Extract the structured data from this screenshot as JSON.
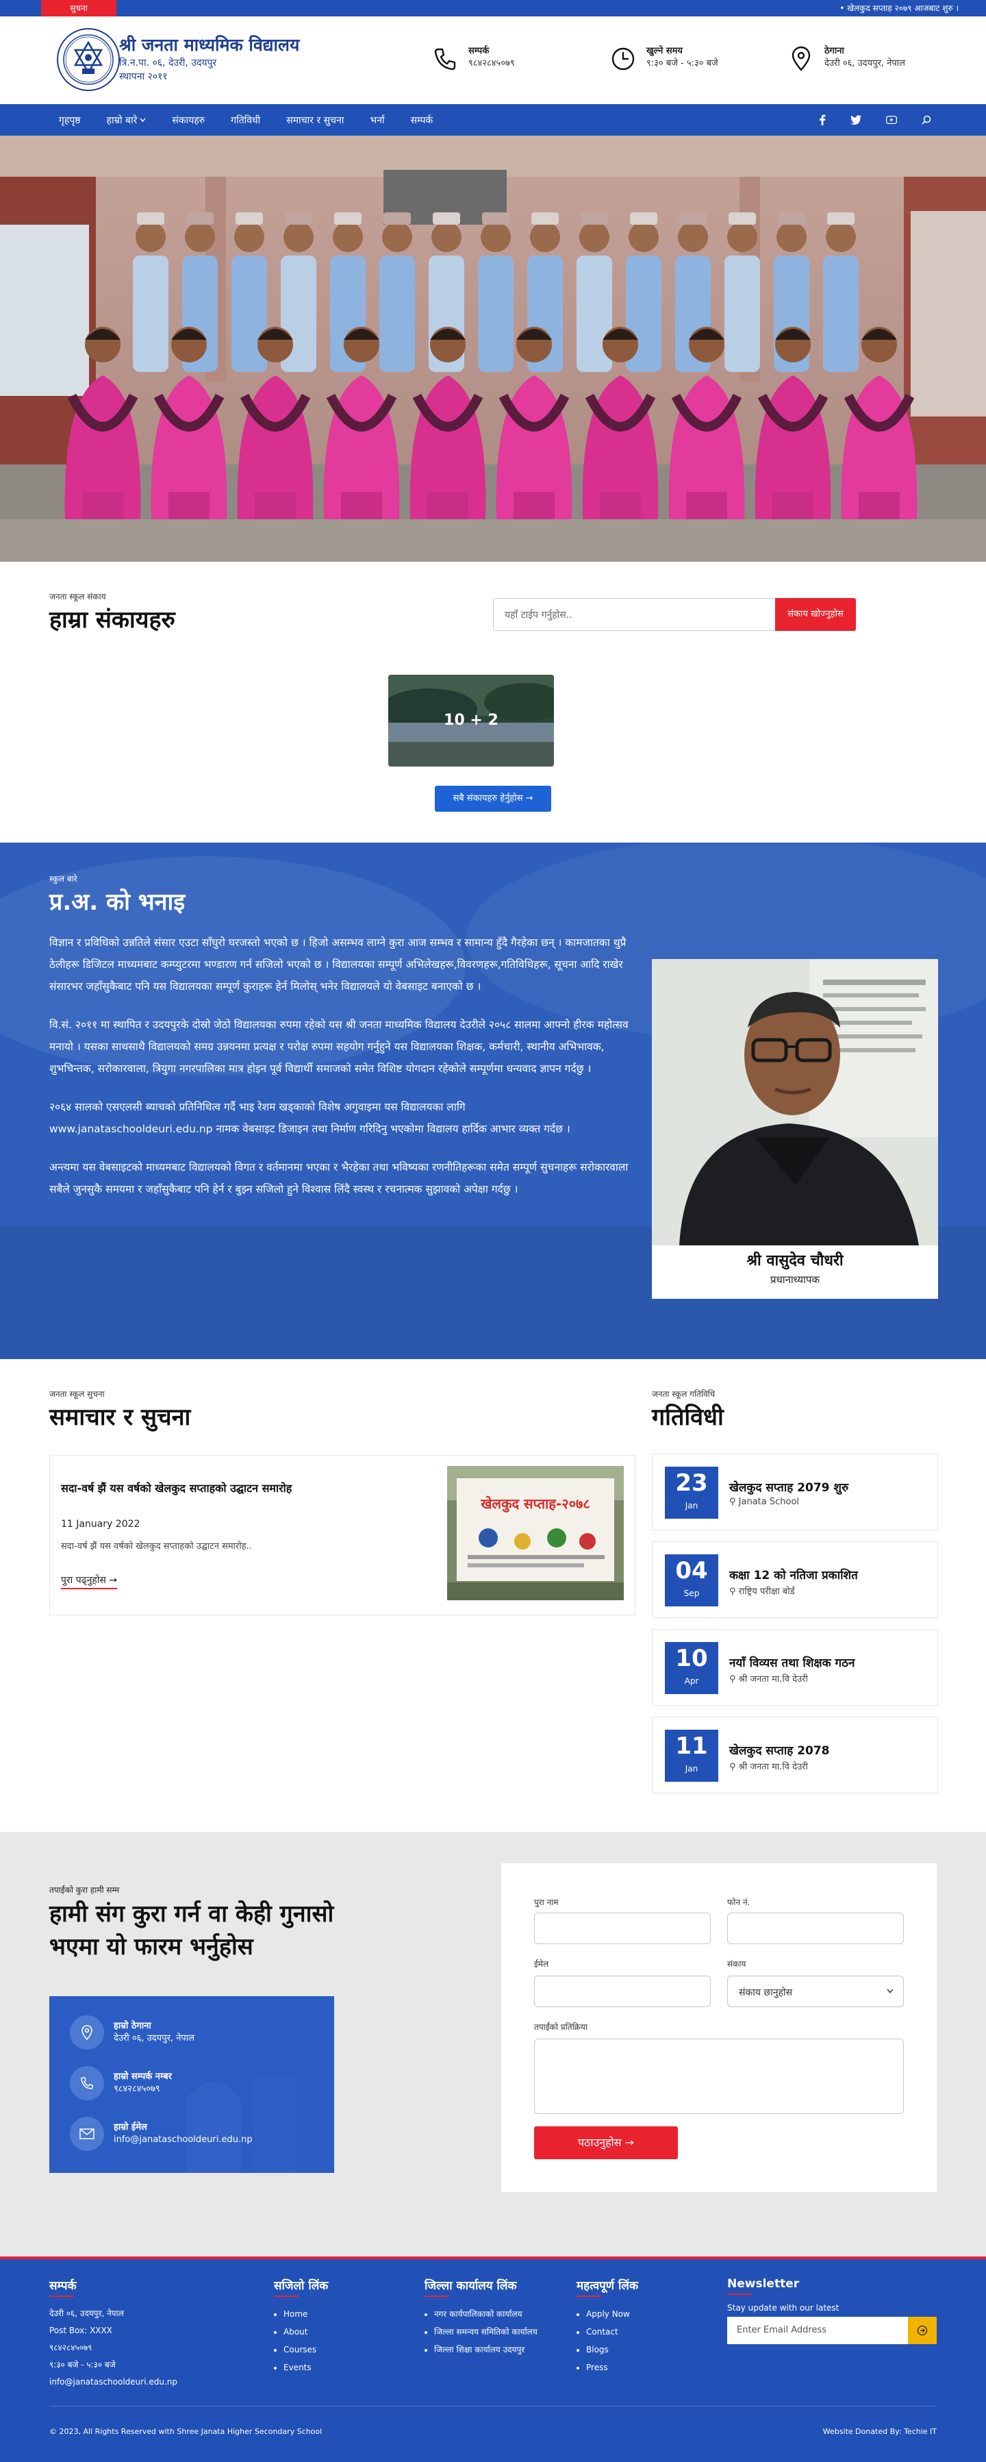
{
  "notice": {
    "label": "सुचना",
    "ticker": "खेलकुद सप्ताह २०७९ आजबाट शुरु ।"
  },
  "header": {
    "school_name": "श्री जनता माध्यमिक विद्यालय",
    "address_line": "त्रि.न.पा. ०६, देउरी, उदयपुर",
    "established_line": "स्थापना २०११",
    "contact": {
      "title": "सम्पर्क",
      "value": "९८४२८४५०७९"
    },
    "hours": {
      "title": "खुल्ने समय",
      "value": "९:३० बजे - ५:३० बजे"
    },
    "location": {
      "title": "ठेगाना",
      "value": "देउरी ०६, उदयपुर, नेपाल"
    }
  },
  "nav": {
    "items": [
      "गृहपृष्ठ",
      "हाम्रो बारे",
      "संकायहरु",
      "गतिविधी",
      "समाचार र सुचना",
      "भर्ना",
      "सम्पर्क"
    ],
    "icons": [
      "facebook-icon",
      "twitter-icon",
      "youtube-icon",
      "search-icon"
    ]
  },
  "certificates": {
    "eyebrow": "जनता स्कूल संकाय",
    "title": "हाम्रा संकायहरु",
    "search_placeholder": "यहाँ टाईप गर्नुहोस..",
    "search_button": "संकाय खोज्नुहोस",
    "card_label": "10 + 2",
    "all_button": "सबै संकायहरु हेर्नुहोस →"
  },
  "principal": {
    "eyebrow": "स्कुल बारे",
    "title": "प्र.अ. को भनाइ",
    "paragraphs": [
      "विज्ञान र प्रविधिको उन्नतिले संसार एउटा साँघुरो घरजस्तो भएको छ । हिजो असम्भव लाग्ने कुरा आज सम्भव र सामान्य हुँदै गैरहेका छन् । कामजातका थुप्रै ठेलीहरू डिजिटल माध्यमबाट कम्प्युटरमा भण्डारण गर्न सजिलो भएको छ । विद्यालयका सम्पूर्ण अभिलेखहरू,विवरणहरू,गतिविधिहरू, सूचना आदि राखेर संसारभर जहाँसुकैबाट पनि यस विद्यालयका सम्पूर्ण कुराहरू हेर्न मिलोस् भनेर विद्यालयले यो वेबसाइट बनाएको छ ।",
      "वि.सं. २०११ मा स्थापित र उदयपुरके दोस्रो जेठो विद्यालयका रुपमा रहेको यस श्री जनता माध्यमिक विद्यालय देउरीले २०५८ सालमा आफ्नो हीरक महोत्सव मनायो । यसका साथसाथै विद्यालयको समग्र उन्नयनमा प्रत्यक्ष र परोक्ष रुपमा सहयोग गर्नुहुने यस विद्यालयका शिक्षक, कर्मचारी, स्थानीय अभिभावक, शुभचिन्तक, सरोकारवाला, त्रियुगा नगरपालिका मात्र होइन पूर्व विद्यार्थी समाजको समेत विशिष्ट योगदान रहेकोले सम्पूर्णमा धन्यवाद ज्ञापन गर्दछु ।",
      "२०६४ सालको एसएलसी ब्याचको प्रतिनिधित्व गर्दै भाइ रेशम खड्काको विशेष अगुवाइमा यस विद्यालयका लागि www.janataschooldeuri.edu.np नामक वेबसाइट डिजाइन तथा निर्माण गरिदिनु भएकोमा विद्यालय हार्दिक आभार व्यक्त गर्दछ ।",
      "अन्त्यमा यस वेबसाइटको माध्यमबाट विद्यालयको विगत र वर्तमानमा भएका र भैरहेका तथा भविष्यका रणनीतिहरूका समेत सम्पूर्ण सुचनाहरू सरोकारवाला सबैले जुनसुकै समयमा र जहाँसुकैबाट पनि हेर्न र बुझ्न सजिलो हुने विश्वास लिंदै स्वस्थ र रचनात्मक सुझावको अपेक्षा गर्दछु ।"
    ],
    "name": "श्री वासुदेव चौधरी",
    "role": "प्रधानाध्यापक"
  },
  "news": {
    "eyebrow": "जनता स्कूल सुचना",
    "title": "समाचार र सुचना",
    "item": {
      "title": "सदा-वर्ष झैं यस वर्षको खेलकुद सप्ताहको उद्घाटन समारोह",
      "date": "11 January 2022",
      "excerpt": "सदा-वर्ष झैं यस वर्षको खेलकुद सप्ताहको उद्घाटन समारोह..",
      "more": "पुरा पढ्नुहोस →",
      "banner_text": "खेलकुद सप्ताह-२०७८"
    }
  },
  "activities": {
    "eyebrow": "जनता स्कूल गतिविधि",
    "title": "गतिविधी",
    "items": [
      {
        "day": "23",
        "month": "Jan",
        "title": "खेलकुद सप्ताह 2079 शुरु",
        "location": "Janata School"
      },
      {
        "day": "04",
        "month": "Sep",
        "title": "कक्षा 12 को नतिजा प्रकाशित",
        "location": "राष्ट्रिय परीक्षा बोर्ड"
      },
      {
        "day": "10",
        "month": "Apr",
        "title": "नयाँ विव्यस तथा शिक्षक गठन",
        "location": "श्री जनता मा.वि देउरी"
      },
      {
        "day": "11",
        "month": "Jan",
        "title": "खेलकुद सप्ताह 2078",
        "location": "श्री जनता मा.वि देउरी"
      }
    ]
  },
  "contact": {
    "eyebrow": "तपाईंको कुरा हामी सम्म",
    "title": "हामी संग कुरा गर्न वा केही गुनासो भएमा यो फारम भर्नुहोस",
    "items": [
      {
        "title": "हाम्रो ठेगाना",
        "value": "देउरी ०६, उदयपुर, नेपाल"
      },
      {
        "title": "हाम्रो सम्पर्क नम्बर",
        "value": "९८४२८४५०७९"
      },
      {
        "title": "हाम्रो ईमेल",
        "value": "info@janataschooldeuri.edu.np"
      }
    ],
    "form": {
      "name_label": "पुरा नाम",
      "phone_label": "फोन नं.",
      "email_label": "ईमेल",
      "faculty_label": "संकाय",
      "faculty_value": "संकाय छानुहोस",
      "message_label": "तपाईंको प्रतिक्रिया",
      "submit": "पठाउनुहोस →"
    }
  },
  "footer": {
    "contact_title": "सम्पर्क",
    "contact_lines": [
      "देउरी ०६, उदयपुर, नेपाल",
      "Post Box: XXXX",
      "९८४२८४५०७९",
      "९:३० बजे - ५:३० बजे",
      "info@janataschooldeuri.edu.np"
    ],
    "useful_title": "सजिलो लिंक",
    "useful_links": [
      "Home",
      "About",
      "Courses",
      "Events"
    ],
    "district_title": "जिल्ला कार्यालय लिंक",
    "district_links": [
      "नगर कार्यपालिकाको कार्यालय",
      "जिल्ला समन्वय समितिको कार्यालय",
      "जिल्ला शिक्षा कार्यालय उदयपुर"
    ],
    "important_title": "महत्वपूर्ण लिंक",
    "important_links": [
      "Apply Now",
      "Contact",
      "Blogs",
      "Press"
    ],
    "newsletter_title": "Newsletter",
    "newsletter_label": "Stay update with our latest",
    "newsletter_placeholder": "Enter Email Address",
    "copyright": "© 2023, All Rights Reserved with Shree Janata Higher Secondary School",
    "donated": "Website Donated By: Techie IT"
  }
}
